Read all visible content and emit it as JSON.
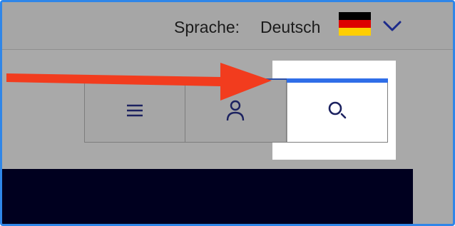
{
  "header": {
    "language_label": "Sprache:",
    "language_value": "Deutsch",
    "flag_colors": [
      "#000000",
      "#dd0000",
      "#ffce00"
    ],
    "dropdown_icon": "chevron-down-icon"
  },
  "nav": {
    "items": [
      {
        "name": "menu",
        "icon": "hamburger-menu-icon"
      },
      {
        "name": "account",
        "icon": "user-icon"
      },
      {
        "name": "search",
        "icon": "search-icon",
        "highlighted": true
      }
    ]
  },
  "annotation": {
    "arrow_color": "#f23c1e",
    "highlight_color": "#2f6ee8"
  },
  "colors": {
    "icon": "#1c2260",
    "banner": "#00001f",
    "frame": "#2f86e8"
  }
}
